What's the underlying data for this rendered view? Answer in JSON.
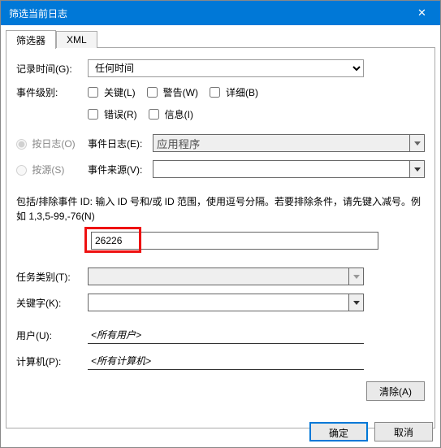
{
  "window": {
    "title": "筛选当前日志",
    "close_icon": "✕"
  },
  "tabs": {
    "filter": "筛选器",
    "xml": "XML"
  },
  "labels": {
    "logged": "记录时间(G):",
    "level": "事件级别:",
    "by_log": "按日志(O)",
    "by_source": "按源(S)",
    "event_logs": "事件日志(E):",
    "event_sources": "事件来源(V):",
    "hint": "包括/排除事件 ID: 输入 ID 号和/或 ID 范围，使用逗号分隔。若要排除条件，请先键入减号。例如 1,3,5-99,-76(N)",
    "task_category": "任务类别(T):",
    "keywords": "关键字(K):",
    "user": "用户(U):",
    "computer": "计算机(P):"
  },
  "values": {
    "logged_time": "任何时间",
    "event_log_selected": "应用程序",
    "event_source_selected": "",
    "event_id": "26226",
    "task_category": "",
    "keywords": "",
    "user": "<所有用户>",
    "computer": "<所有计算机>"
  },
  "checkboxes": {
    "critical": "关键(L)",
    "warning": "警告(W)",
    "verbose": "详细(B)",
    "error": "错误(R)",
    "information": "信息(I)"
  },
  "buttons": {
    "clear": "清除(A)",
    "ok": "确定",
    "cancel": "取消"
  }
}
